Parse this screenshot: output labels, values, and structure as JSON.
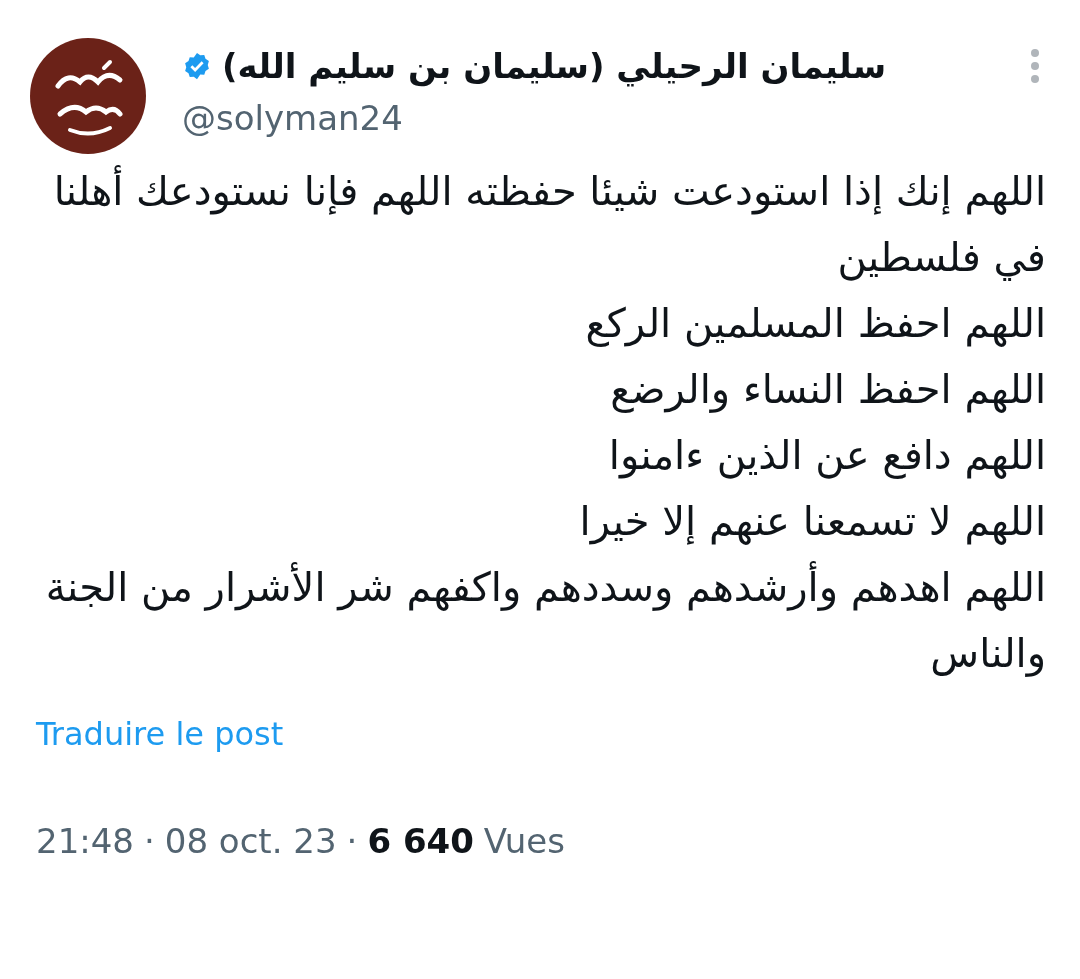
{
  "author": {
    "name": "سليمان الرحيلي (سليمان بن سليم الله)",
    "verified": true,
    "handle": "@solyman24"
  },
  "body": [
    "اللهم إنك إذا استودعت شيئا حفظته اللهم فإنا نستودعك أهلنا في فلسطين",
    "اللهم احفظ المسلمين الركع",
    "اللهم احفظ النساء والرضع",
    "اللهم دافع عن الذين ءامنوا",
    "اللهم لا تسمعنا عنهم إلا خيرا",
    "اللهم اهدهم وأرشدهم وسددهم واكفهم شر الأشرار من الجنة والناس"
  ],
  "translate_link": "Traduire le post",
  "meta": {
    "time": "21:48",
    "date": "08 oct. 23",
    "views_count": "6 640",
    "views_label": "Vues",
    "separator": "·"
  }
}
